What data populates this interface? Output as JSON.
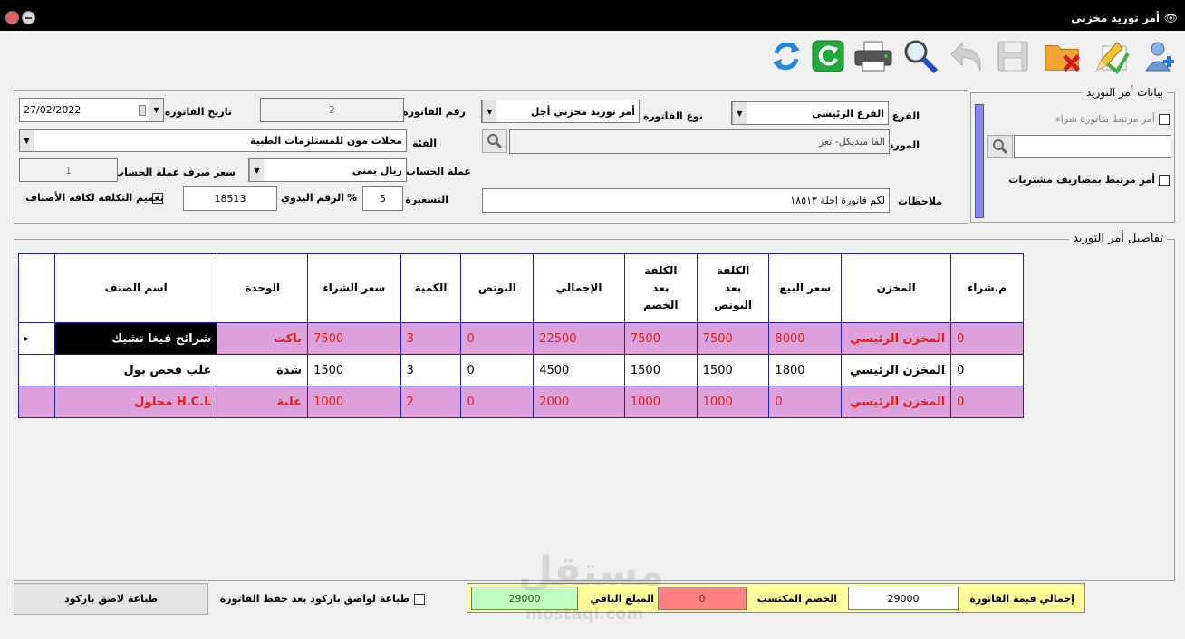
{
  "window": {
    "title": "أمر توريد مخزني"
  },
  "toolbar": {
    "icons": [
      "add-user-icon",
      "edit-icon",
      "delete-folder-icon",
      "save-icon",
      "undo-icon",
      "search-icon",
      "print-icon",
      "refresh-icon",
      "sync-icon"
    ]
  },
  "supply": {
    "title": "بيانات أمر التوريد",
    "linked_purchase_invoice": "أمر مرتبط بفاتورة شراء",
    "linked_purchase_expenses": "أمر مرتبط بمصاريف مشتريات"
  },
  "form": {
    "branch_label": "الفرع",
    "branch_value": "الفرع الرئيسي",
    "invoice_type_label": "نوع الفاتورة",
    "invoice_type_value": "أمر توريد مخزني أجل",
    "invoice_no_label": "رقم الفاتورة",
    "invoice_no_value": "2",
    "invoice_date_label": "تاريخ الفاتورة",
    "invoice_date_value": "27/02/2022",
    "supplier_label": "المورد",
    "supplier_value": "الفا ميديكل- تعز",
    "category_label": "الفئة",
    "category_value": "محلات مون للمستلزمات الطبية",
    "account_currency_label": "عملة الحساب",
    "account_currency_value": "ريال يمني",
    "exchange_rate_label": "سعر صرف عملة الحساب",
    "exchange_rate_value": "1",
    "notes_label": "ملاحظات",
    "notes_value": "لكم فاتورة اجلة ١٨٥١٣",
    "pricing_label": "التسعيرة",
    "pricing_value": "5",
    "percent_sign": "%",
    "manual_no_label": "الرقم اليدوي",
    "manual_no_value": "18513",
    "generalize_cost_label": "تعميم التكلفة لكافة الأصناف"
  },
  "details": {
    "title": "تفاصيل أمر التوريد",
    "columns": {
      "purchase_no": "م.شراء",
      "warehouse": "المخزن",
      "sell_price": "سعر البيع",
      "cost_after_bonus": "الكلفة\nبعد\nالبونص",
      "cost_after_discount": "الكلفة\nبعد\nالخصم",
      "total": "الإجمالي",
      "bonus": "البونص",
      "quantity": "الكمية",
      "buy_price": "سعر الشراء",
      "unit": "الوحدة",
      "item_name": "اسم الصنف"
    },
    "rows": [
      {
        "purchase_no": "0",
        "warehouse": "المخزن الرئيسي",
        "sell_price": "8000",
        "cost_after_bonus": "7500",
        "cost_after_discount": "7500",
        "total": "22500",
        "bonus": "0",
        "quantity": "3",
        "buy_price": "7500",
        "unit": "باكت",
        "item_name": "شرائح فيغا تشيك",
        "indicator": "▸"
      },
      {
        "purchase_no": "0",
        "warehouse": "المخزن الرئيسي",
        "sell_price": "1800",
        "cost_after_bonus": "1500",
        "cost_after_discount": "1500",
        "total": "4500",
        "bonus": "0",
        "quantity": "3",
        "buy_price": "1500",
        "unit": "شدة",
        "item_name": "علب فحص بول",
        "indicator": ""
      },
      {
        "purchase_no": "0",
        "warehouse": "المخزن الرئيسي",
        "sell_price": "0",
        "cost_after_bonus": "1000",
        "cost_after_discount": "1000",
        "total": "2000",
        "bonus": "0",
        "quantity": "2",
        "buy_price": "1000",
        "unit": "علبة",
        "item_name": "H.C.L محلول",
        "indicator": ""
      }
    ]
  },
  "footer": {
    "print_barcode_button": "طباعة لاصق باركود",
    "print_after_save_label": "طباعة لواصق باركود بعد حفظ الفاتورة",
    "invoice_total_label": "إجمالي قيمة الفاتورة",
    "invoice_total_value": "29000",
    "earned_discount_label": "الخصم المكتسب",
    "earned_discount_value": "0",
    "remaining_label": "المبلغ الباقي",
    "remaining_value": "29000"
  },
  "watermark": {
    "text": "مستقل",
    "sub": "mostaql.com"
  },
  "colors": {
    "pink_row": "#dda1dc",
    "red_text": "#e0201a",
    "grid_border": "#1f1f9e",
    "summary_bg": "#ffff99",
    "green_field": "#bfffbf",
    "red_field": "#ff8080",
    "side_bar": "#8a8ae8"
  }
}
